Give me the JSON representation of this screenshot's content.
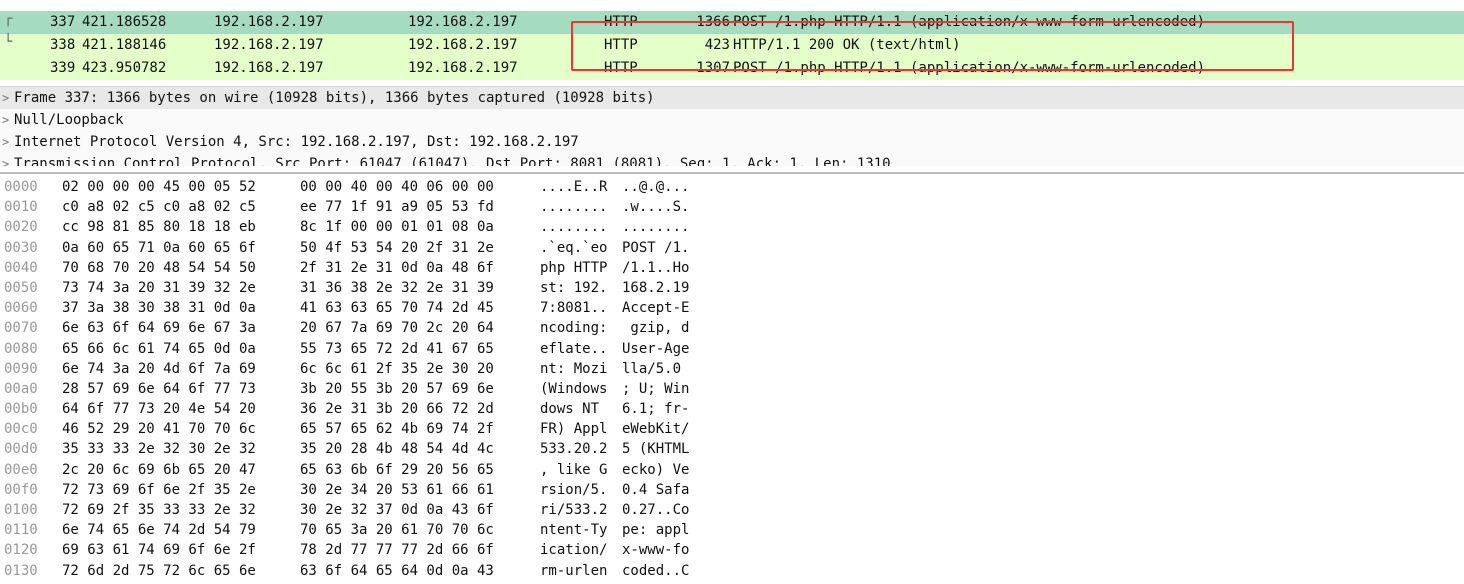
{
  "packets": [
    {
      "no": "337",
      "time": "421.186528",
      "source": "192.168.2.197",
      "destination": "192.168.2.197",
      "protocol": "HTTP",
      "length": "1366",
      "info": "POST /1.php HTTP/1.1  (application/x-www-form-urlencoded)",
      "relation_glyph": "┌"
    },
    {
      "no": "338",
      "time": "421.188146",
      "source": "192.168.2.197",
      "destination": "192.168.2.197",
      "protocol": "HTTP",
      "length": "423",
      "info": "HTTP/1.1 200 OK  (text/html)",
      "relation_glyph": "└"
    },
    {
      "no": "339",
      "time": "423.950782",
      "source": "192.168.2.197",
      "destination": "192.168.2.197",
      "protocol": "HTTP",
      "length": "1307",
      "info": "POST /1.php HTTP/1.1  (application/x-www-form-urlencoded)",
      "relation_glyph": ""
    }
  ],
  "details": [
    {
      "arrow": ">",
      "text": "Frame 337: 1366 bytes on wire (10928 bits), 1366 bytes captured (10928 bits)"
    },
    {
      "arrow": ">",
      "text": "Null/Loopback"
    },
    {
      "arrow": ">",
      "text": "Internet Protocol Version 4, Src: 192.168.2.197, Dst: 192.168.2.197"
    },
    {
      "arrow": ">",
      "text": "Transmission Control Protocol, Src Port: 61047 (61047), Dst Port: 8081 (8081), Seq: 1, Ack: 1, Len: 1310"
    }
  ],
  "bytes": [
    {
      "offset": "0000",
      "hex1": "02 00 00 00 45 00 05 52",
      "hex2": "00 00 40 00 40 06 00 00",
      "ascii1": "....E..R",
      "ascii2": "..@.@..."
    },
    {
      "offset": "0010",
      "hex1": "c0 a8 02 c5 c0 a8 02 c5",
      "hex2": "ee 77 1f 91 a9 05 53 fd",
      "ascii1": "........",
      "ascii2": ".w....S."
    },
    {
      "offset": "0020",
      "hex1": "cc 98 81 85 80 18 18 eb",
      "hex2": "8c 1f 00 00 01 01 08 0a",
      "ascii1": "........",
      "ascii2": "........"
    },
    {
      "offset": "0030",
      "hex1": "0a 60 65 71 0a 60 65 6f",
      "hex2": "50 4f 53 54 20 2f 31 2e",
      "ascii1": ".`eq.`eo",
      "ascii2": "POST /1."
    },
    {
      "offset": "0040",
      "hex1": "70 68 70 20 48 54 54 50",
      "hex2": "2f 31 2e 31 0d 0a 48 6f",
      "ascii1": "php HTTP",
      "ascii2": "/1.1..Ho"
    },
    {
      "offset": "0050",
      "hex1": "73 74 3a 20 31 39 32 2e",
      "hex2": "31 36 38 2e 32 2e 31 39",
      "ascii1": "st: 192.",
      "ascii2": "168.2.19"
    },
    {
      "offset": "0060",
      "hex1": "37 3a 38 30 38 31 0d 0a",
      "hex2": "41 63 63 65 70 74 2d 45",
      "ascii1": "7:8081..",
      "ascii2": "Accept-E"
    },
    {
      "offset": "0070",
      "hex1": "6e 63 6f 64 69 6e 67 3a",
      "hex2": "20 67 7a 69 70 2c 20 64",
      "ascii1": "ncoding:",
      "ascii2": " gzip, d"
    },
    {
      "offset": "0080",
      "hex1": "65 66 6c 61 74 65 0d 0a",
      "hex2": "55 73 65 72 2d 41 67 65",
      "ascii1": "eflate..",
      "ascii2": "User-Age"
    },
    {
      "offset": "0090",
      "hex1": "6e 74 3a 20 4d 6f 7a 69",
      "hex2": "6c 6c 61 2f 35 2e 30 20",
      "ascii1": "nt: Mozi",
      "ascii2": "lla/5.0 "
    },
    {
      "offset": "00a0",
      "hex1": "28 57 69 6e 64 6f 77 73",
      "hex2": "3b 20 55 3b 20 57 69 6e",
      "ascii1": "(Windows",
      "ascii2": "; U; Win"
    },
    {
      "offset": "00b0",
      "hex1": "64 6f 77 73 20 4e 54 20",
      "hex2": "36 2e 31 3b 20 66 72 2d",
      "ascii1": "dows NT ",
      "ascii2": "6.1; fr-"
    },
    {
      "offset": "00c0",
      "hex1": "46 52 29 20 41 70 70 6c",
      "hex2": "65 57 65 62 4b 69 74 2f",
      "ascii1": "FR) Appl",
      "ascii2": "eWebKit/"
    },
    {
      "offset": "00d0",
      "hex1": "35 33 33 2e 32 30 2e 32",
      "hex2": "35 20 28 4b 48 54 4d 4c",
      "ascii1": "533.20.2",
      "ascii2": "5 (KHTML"
    },
    {
      "offset": "00e0",
      "hex1": "2c 20 6c 69 6b 65 20 47",
      "hex2": "65 63 6b 6f 29 20 56 65",
      "ascii1": ", like G",
      "ascii2": "ecko) Ve"
    },
    {
      "offset": "00f0",
      "hex1": "72 73 69 6f 6e 2f 35 2e",
      "hex2": "30 2e 34 20 53 61 66 61",
      "ascii1": "rsion/5.",
      "ascii2": "0.4 Safa"
    },
    {
      "offset": "0100",
      "hex1": "72 69 2f 35 33 33 2e 32",
      "hex2": "30 2e 32 37 0d 0a 43 6f",
      "ascii1": "ri/533.2",
      "ascii2": "0.27..Co"
    },
    {
      "offset": "0110",
      "hex1": "6e 74 65 6e 74 2d 54 79",
      "hex2": "70 65 3a 20 61 70 70 6c",
      "ascii1": "ntent-Ty",
      "ascii2": "pe: appl"
    },
    {
      "offset": "0120",
      "hex1": "69 63 61 74 69 6f 6e 2f",
      "hex2": "78 2d 77 77 77 2d 66 6f",
      "ascii1": "ication/",
      "ascii2": "x-www-fo"
    },
    {
      "offset": "0130",
      "hex1": "72 6d 2d 75 72 6c 65 6e",
      "hex2": "63 6f 64 65 64 0d 0a 43",
      "ascii1": "rm-urlen",
      "ascii2": "coded..C"
    }
  ],
  "colors": {
    "selected_row": "#a5dcbf",
    "http_row": "#e4ffc7",
    "highlight_box": "#e53935"
  }
}
